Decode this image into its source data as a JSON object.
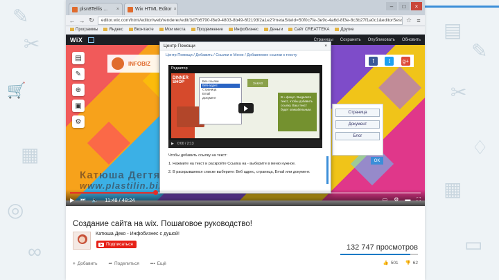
{
  "browser": {
    "tabs": [
      {
        "label": "plsn8Tellis ...",
        "active": false
      },
      {
        "label": "Wix HTML Editor",
        "active": true
      }
    ],
    "url": "editor.wix.com/html/editor/web/renderer/edit/3d7b6790-f8e9-4803-8b49-6f2193f2a1e2?metaSiteId=50f0c7fe-3e9c-4a6d-8f3e-8c3b27f1a0c1&editorSessionId=...",
    "bookmarks": [
      "Программы",
      "Яндекс",
      "Вконтакте",
      "Мои места",
      "Продвижение",
      "Инфобизнес",
      "Деньги",
      "Сайт CREATTEKA",
      "Другие"
    ]
  },
  "wix": {
    "logo": "WiX",
    "menu": [
      "Страницы",
      "Сохранить",
      "Опубликовать",
      "Обновить"
    ]
  },
  "site": {
    "brand": "INFOBIZ"
  },
  "social": [
    "f",
    "t",
    "g+"
  ],
  "sidepanel": {
    "buttons": [
      "Страница",
      "Документ",
      "Блог"
    ],
    "ok": "OK"
  },
  "modal": {
    "title": "Центр Помощи",
    "close": "×",
    "breadcrumbs": "Центр Помощи / Добавить / Ссылки и Меню / Добавление ссылки к тексту",
    "embed_title": "Редактор",
    "embed_brand": "DINNER SHOP",
    "dropdown": [
      "Без ссылки",
      "Веб-адрес",
      "Страница",
      "Email",
      "Документ"
    ],
    "green_text": "В » фокус. Выделите текст, чтобы добавить ссылку. Ваш текст будет кликабельным.",
    "olive": "ЗАКАЗ",
    "embed_time": "0:00 / 2:13",
    "text": [
      "Чтобы добавить ссылку на текст:",
      "1. Нажмите на текст и раскройте Ссылка на - выберите в меню нужное.",
      "2. В раскрывшемся списке выберите: Веб адрес, страница, Email или документ."
    ]
  },
  "watermark": {
    "line1": "Катюша Дегтярева",
    "line2": "www.plastilin.biz"
  },
  "player": {
    "time": "11:48 / 48:24",
    "progress": 0.243
  },
  "video": {
    "title": "Создание сайта на wix. Пошаговое руководство!",
    "channel": "Катюша Деко - Инфобизнес с душой!",
    "subscribe": "Подписаться",
    "views": "132 747 просмотров",
    "like_ratio": 0.9
  },
  "actions": {
    "add": "Добавить",
    "share": "Поделиться",
    "more": "Ещё",
    "likes": "501",
    "dislikes": "62"
  },
  "colors": {
    "accent": "#e52d27",
    "link": "#167ac6"
  }
}
